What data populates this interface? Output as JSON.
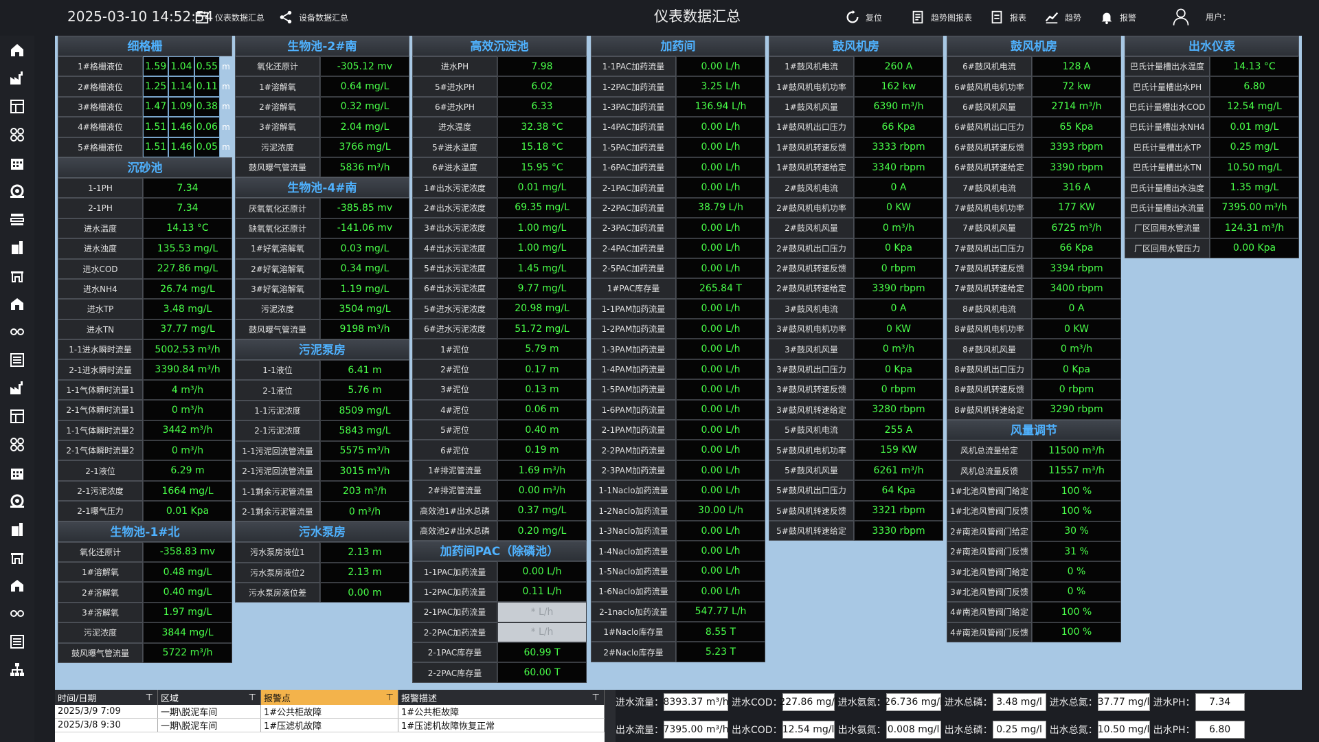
{
  "topbar": {
    "datetime": "2025-03-10 14:52:54",
    "title": "仪表数据汇总",
    "nav_instrument": "仪表数据汇总",
    "nav_device": "设备数据汇总",
    "reset": "复位",
    "trend_report": "趋势图报表",
    "report": "报表",
    "trend": "趋势",
    "alarm": "报警",
    "user": "用户："
  },
  "grille": {
    "title": "细格栅",
    "unit": "m",
    "rows": [
      {
        "label": "1#格栅液位",
        "v": [
          "1.59",
          "1.04",
          "0.55"
        ]
      },
      {
        "label": "2#格栅液位",
        "v": [
          "1.25",
          "1.14",
          "0.11"
        ]
      },
      {
        "label": "3#格栅液位",
        "v": [
          "1.47",
          "1.09",
          "0.38"
        ]
      },
      {
        "label": "4#格栅液位",
        "v": [
          "1.51",
          "1.46",
          "0.06"
        ]
      },
      {
        "label": "5#格栅液位",
        "v": [
          "1.51",
          "1.46",
          "0.05"
        ]
      }
    ]
  },
  "sections": [
    {
      "key": "s_sand",
      "title": "沉砂池",
      "rows": [
        [
          "1-1PH",
          "7.34"
        ],
        [
          "2-1PH",
          "7.34"
        ],
        [
          "进水温度",
          "14.13 °C"
        ],
        [
          "进水浊度",
          "135.53 mg/L"
        ],
        [
          "进水COD",
          "227.86 mg/L"
        ],
        [
          "进水NH4",
          "26.74 mg/L"
        ],
        [
          "进水TP",
          "3.48 mg/L"
        ],
        [
          "进水TN",
          "37.77 mg/L"
        ],
        [
          "1-1进水瞬时流量",
          "5002.53 m³/h"
        ],
        [
          "2-1进水瞬时流量",
          "3390.84 m³/h"
        ],
        [
          "1-1气体瞬时流量1",
          "4 m³/h"
        ],
        [
          "2-1气体瞬时流量1",
          "0 m³/h"
        ],
        [
          "1-1气体瞬时流量2",
          "3442 m³/h"
        ],
        [
          "2-1气体瞬时流量2",
          "0 m³/h"
        ],
        [
          "2-1液位",
          "6.29 m"
        ],
        [
          "2-1污泥浓度",
          "1664 mg/L"
        ],
        [
          "2-1曝气压力",
          "0.01 Kpa"
        ]
      ]
    },
    {
      "key": "s_bio1n",
      "title": "生物池-1#北",
      "rows": [
        [
          "氧化还原计",
          "-358.83 mv"
        ],
        [
          "1#溶解氧",
          "0.48 mg/L"
        ],
        [
          "2#溶解氧",
          "0.40 mg/L"
        ],
        [
          "3#溶解氧",
          "1.97 mg/L"
        ],
        [
          "污泥浓度",
          "3844 mg/L"
        ],
        [
          "鼓风曝气管流量",
          "5722 m³/h"
        ]
      ]
    },
    {
      "key": "s_bio2s",
      "title": "生物池-2#南",
      "rows": [
        [
          "氧化还原计",
          "-305.12 mv"
        ],
        [
          "1#溶解氧",
          "0.64 mg/L"
        ],
        [
          "2#溶解氧",
          "0.32 mg/L"
        ],
        [
          "3#溶解氧",
          "2.04 mg/L"
        ],
        [
          "污泥浓度",
          "3766 mg/L"
        ],
        [
          "鼓风曝气管流量",
          "5836 m³/h"
        ]
      ]
    },
    {
      "key": "s_bio4s",
      "title": "生物池-4#南",
      "rows": [
        [
          "厌氧氧化还原计",
          "-385.85 mv"
        ],
        [
          "缺氧氧化还原计",
          "-141.06 mv"
        ],
        [
          "1#好氧溶解氧",
          "0.03 mg/L"
        ],
        [
          "2#好氧溶解氧",
          "0.34 mg/L"
        ],
        [
          "3#好氧溶解氧",
          "1.19 mg/L"
        ],
        [
          "污泥浓度",
          "3504 mg/L"
        ],
        [
          "鼓风曝气管流量",
          "9198 m³/h"
        ]
      ]
    },
    {
      "key": "s_sludge",
      "title": "污泥泵房",
      "rows": [
        [
          "1-1液位",
          "6.41 m"
        ],
        [
          "2-1液位",
          "5.76 m"
        ],
        [
          "1-1污泥浓度",
          "8509 mg/L"
        ],
        [
          "2-1污泥浓度",
          "5843 mg/L"
        ],
        [
          "1-1污泥回流管流量",
          "5575 m³/h"
        ],
        [
          "2-1污泥回流管流量",
          "3015 m³/h"
        ],
        [
          "1-1剩余污泥管流量",
          "203 m³/h"
        ],
        [
          "2-1剩余污泥管流量",
          "0 m³/h"
        ]
      ]
    },
    {
      "key": "s_sewage",
      "title": "污水泵房",
      "rows": [
        [
          "污水泵房液位1",
          "2.13 m"
        ],
        [
          "污水泵房液位2",
          "2.13 m"
        ],
        [
          "污水泵房液位差",
          "0.00 m"
        ]
      ]
    },
    {
      "key": "s_sed",
      "title": "高效沉淀池",
      "rows": [
        [
          "进水PH",
          "7.98"
        ],
        [
          "5#进水PH",
          "6.02"
        ],
        [
          "6#进水PH",
          "6.33"
        ],
        [
          "进水温度",
          "32.38 °C"
        ],
        [
          "5#进水温度",
          "15.18 °C"
        ],
        [
          "6#进水温度",
          "15.95 °C"
        ],
        [
          "1#出水污泥浓度",
          "0.01 mg/L"
        ],
        [
          "2#出水污泥浓度",
          "69.35 mg/L"
        ],
        [
          "3#出水污泥浓度",
          "1.00 mg/L"
        ],
        [
          "4#出水污泥浓度",
          "1.00 mg/L"
        ],
        [
          "5#出水污泥浓度",
          "1.45 mg/L"
        ],
        [
          "6#出水污泥浓度",
          "9.77 mg/L"
        ],
        [
          "5#进水污泥浓度",
          "20.98 mg/L"
        ],
        [
          "6#进水污泥浓度",
          "51.72 mg/L"
        ],
        [
          "1#泥位",
          "5.79 m"
        ],
        [
          "2#泥位",
          "0.17 m"
        ],
        [
          "3#泥位",
          "0.13 m"
        ],
        [
          "4#泥位",
          "0.06 m"
        ],
        [
          "5#泥位",
          "0.40 m"
        ],
        [
          "6#泥位",
          "0.19 m"
        ],
        [
          "1#排泥管流量",
          "1.69 m³/h"
        ],
        [
          "2#排泥管流量",
          "0.00 m³/h"
        ],
        [
          "高效池1#出水总磷",
          "0.37 mg/L"
        ],
        [
          "高效池2#出水总磷",
          "0.20 mg/L"
        ]
      ]
    },
    {
      "key": "s_pac",
      "title": "加药间PAC（除磷池）",
      "rows": [
        [
          "1-1PAC加药流量",
          "0.00 L/h"
        ],
        [
          "1-2PAC加药流量",
          "0.11 L/h"
        ],
        [
          "2-1PAC加药流量",
          "* L/h"
        ],
        [
          "2-2PAC加药流量",
          "* L/h"
        ],
        [
          "2-1PAC库存量",
          "60.99 T"
        ],
        [
          "2-2PAC库存量",
          "60.00 T"
        ]
      ]
    },
    {
      "key": "s_dose",
      "title": "加药间",
      "rows": [
        [
          "1-1PAC加药流量",
          "0.00 L/h"
        ],
        [
          "1-2PAC加药流量",
          "3.25 L/h"
        ],
        [
          "1-3PAC加药流量",
          "136.94 L/h"
        ],
        [
          "1-4PAC加药流量",
          "0.00 L/h"
        ],
        [
          "1-5PAC加药流量",
          "0.00 L/h"
        ],
        [
          "1-6PAC加药流量",
          "0.00 L/h"
        ],
        [
          "2-1PAC加药流量",
          "0.00 L/h"
        ],
        [
          "2-2PAC加药流量",
          "38.79 L/h"
        ],
        [
          "2-3PAC加药流量",
          "0.00 L/h"
        ],
        [
          "2-4PAC加药流量",
          "0.00 L/h"
        ],
        [
          "2-5PAC加药流量",
          "0.00 L/h"
        ],
        [
          "1#PAC库存量",
          "265.84 T"
        ],
        [
          "1-1PAM加药流量",
          "0.00 L/h"
        ],
        [
          "1-2PAM加药流量",
          "0.00 L/h"
        ],
        [
          "1-3PAM加药流量",
          "0.00 L/h"
        ],
        [
          "1-4PAM加药流量",
          "0.00 L/h"
        ],
        [
          "1-5PAM加药流量",
          "0.00 L/h"
        ],
        [
          "1-6PAM加药流量",
          "0.00 L/h"
        ],
        [
          "2-1PAM加药流量",
          "0.00 L/h"
        ],
        [
          "2-2PAM加药流量",
          "0.00 L/h"
        ],
        [
          "2-3PAM加药流量",
          "0.00 L/h"
        ],
        [
          "1-1Naclo加药流量",
          "0.00 L/h"
        ],
        [
          "1-2Naclo加药流量",
          "30.00 L/h"
        ],
        [
          "1-3Naclo加药流量",
          "0.00 L/h"
        ],
        [
          "1-4Naclo加药流量",
          "0.00 L/h"
        ],
        [
          "1-5Naclo加药流量",
          "0.00 L/h"
        ],
        [
          "1-6Naclo加药流量",
          "0.00 L/h"
        ],
        [
          "2-1naclo加药流量",
          "547.77 L/h"
        ],
        [
          "1#Naclo库存量",
          "8.55 T"
        ],
        [
          "2#Naclo库存量",
          "5.23 T"
        ]
      ]
    },
    {
      "key": "s_blow1",
      "title": "鼓风机房",
      "rows": [
        [
          "1#鼓风机电流",
          "260 A"
        ],
        [
          "1#鼓风机电机功率",
          "162 kw"
        ],
        [
          "1#鼓风机风量",
          "6390 m³/h"
        ],
        [
          "1#鼓风机出口压力",
          "66 Kpa"
        ],
        [
          "1#鼓风机转速反馈",
          "3333 rbpm"
        ],
        [
          "1#鼓风机转速给定",
          "3340 rbpm"
        ],
        [
          "2#鼓风机电流",
          "0 A"
        ],
        [
          "2#鼓风机电机功率",
          "0 KW"
        ],
        [
          "2#鼓风机风量",
          "0 m³/h"
        ],
        [
          "2#鼓风机出口压力",
          "0 Kpa"
        ],
        [
          "2#鼓风机转速反馈",
          "0 rbpm"
        ],
        [
          "2#鼓风机转速给定",
          "3390 rbpm"
        ],
        [
          "3#鼓风机电流",
          "0 A"
        ],
        [
          "3#鼓风机电机功率",
          "0 KW"
        ],
        [
          "3#鼓风机风量",
          "0 m³/h"
        ],
        [
          "3#鼓风机出口压力",
          "0 Kpa"
        ],
        [
          "3#鼓风机转速反馈",
          "0 rbpm"
        ],
        [
          "3#鼓风机转速给定",
          "3280 rbpm"
        ],
        [
          "5#鼓风机电流",
          "255 A"
        ],
        [
          "5#鼓风机电机功率",
          "159 KW"
        ],
        [
          "5#鼓风机风量",
          "6261 m³/h"
        ],
        [
          "5#鼓风机出口压力",
          "64 Kpa"
        ],
        [
          "5#鼓风机转速反馈",
          "3321 rbpm"
        ],
        [
          "5#鼓风机转速给定",
          "3330 rbpm"
        ]
      ]
    },
    {
      "key": "s_blow2",
      "title": "鼓风机房",
      "rows": [
        [
          "6#鼓风机电流",
          "128 A"
        ],
        [
          "6#鼓风机电机功率",
          "72 kw"
        ],
        [
          "6#鼓风机风量",
          "2714 m³/h"
        ],
        [
          "6#鼓风机出口压力",
          "65 Kpa"
        ],
        [
          "6#鼓风机转速反馈",
          "3393 rbpm"
        ],
        [
          "6#鼓风机转速给定",
          "3390 rbpm"
        ],
        [
          "7#鼓风机电流",
          "316 A"
        ],
        [
          "7#鼓风机电机功率",
          "177 KW"
        ],
        [
          "7#鼓风机风量",
          "6725 m³/h"
        ],
        [
          "7#鼓风机出口压力",
          "66 Kpa"
        ],
        [
          "7#鼓风机转速反馈",
          "3394 rbpm"
        ],
        [
          "7#鼓风机转速给定",
          "3400 rbpm"
        ],
        [
          "8#鼓风机电流",
          "0 A"
        ],
        [
          "8#鼓风机电机功率",
          "0 KW"
        ],
        [
          "8#鼓风机风量",
          "0 m³/h"
        ],
        [
          "8#鼓风机出口压力",
          "0 Kpa"
        ],
        [
          "8#鼓风机转速反馈",
          "0 rbpm"
        ],
        [
          "8#鼓风机转速给定",
          "3290 rbpm"
        ]
      ]
    },
    {
      "key": "s_air",
      "title": "风量调节",
      "rows": [
        [
          "风机总流量给定",
          "11500 m³/h"
        ],
        [
          "风机总流量反馈",
          "11557 m³/h"
        ],
        [
          "1#北池风管阀门给定",
          "100 %"
        ],
        [
          "1#北池风管阀门反馈",
          "100 %"
        ],
        [
          "2#南池风管阀门给定",
          "30 %"
        ],
        [
          "2#南池风管阀门反馈",
          "31 %"
        ],
        [
          "3#北池风管阀门给定",
          "0 %"
        ],
        [
          "3#北池风管阀门反馈",
          "0 %"
        ],
        [
          "4#南池风管阀门给定",
          "100 %"
        ],
        [
          "4#南池风管阀门反馈",
          "100 %"
        ]
      ]
    },
    {
      "key": "s_out",
      "title": "出水仪表",
      "rows": [
        [
          "巴氏计量槽出水温度",
          "14.13 °C"
        ],
        [
          "巴氏计量槽出水PH",
          "6.80"
        ],
        [
          "巴氏计量槽出水COD",
          "12.54 mg/L"
        ],
        [
          "巴氏计量槽出水NH4",
          "0.01 mg/L"
        ],
        [
          "巴氏计量槽出水TP",
          "0.25 mg/L"
        ],
        [
          "巴氏计量槽出水TN",
          "10.50 mg/L"
        ],
        [
          "巴氏计量槽出水浊度",
          "1.35 mg/L"
        ],
        [
          "巴氏计量槽出水流量",
          "7395.00 m³/h"
        ],
        [
          "厂区回用水管流量",
          "124.31 m³/h"
        ],
        [
          "厂区回用水管压力",
          "0.00 Kpa"
        ]
      ]
    }
  ],
  "alarm": {
    "headers": [
      "时间/日期",
      "区域",
      "报警点",
      "报警描述"
    ],
    "rows": [
      [
        "2025/3/9 7:09",
        "一期\\脱泥车间",
        "1#公共柜故障",
        "1#公共柜故障"
      ],
      [
        "2025/3/8 9:30",
        "一期\\脱泥车间",
        "1#压滤机故障",
        "1#压滤机故障恢复正常"
      ]
    ]
  },
  "summary": {
    "in": [
      [
        "进水流量：",
        "8393.37 m³/h"
      ],
      [
        "进水COD：",
        "227.86 mg/l"
      ],
      [
        "进水氨氮：",
        "26.736 mg/l"
      ],
      [
        "进水总磷：",
        "3.48 mg/l"
      ],
      [
        "进水总氮：",
        "37.77 mg/l"
      ],
      [
        "进水PH：",
        "7.34"
      ]
    ],
    "out": [
      [
        "出水流量：",
        "7395.00 m³/h"
      ],
      [
        "出水COD：",
        "12.54 mg/l"
      ],
      [
        "出水氨氮：",
        "0.008 mg/l"
      ],
      [
        "出水总磷：",
        "0.25 mg/l"
      ],
      [
        "出水总氮：",
        "10.50 mg/l"
      ],
      [
        "出水PH：",
        "6.80"
      ]
    ]
  },
  "sidebar": [
    "home-icon",
    "factory-icon",
    "panel-icon",
    "fan-icon",
    "building-icon",
    "pump-icon",
    "process-icon",
    "tank-icon",
    "crane-icon",
    "station-icon",
    "link-icon",
    "list-icon",
    "factory-icon",
    "panel-icon",
    "fan-icon",
    "building-icon",
    "pump-icon",
    "tank-icon",
    "crane-icon",
    "station-icon",
    "link-icon",
    "list-icon",
    "org-icon"
  ]
}
